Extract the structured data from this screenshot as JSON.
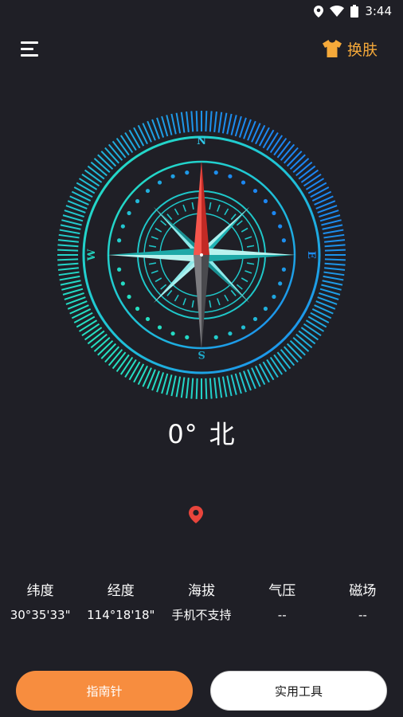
{
  "status_bar": {
    "time": "3:44",
    "icons": [
      "location-icon",
      "wifi-icon",
      "battery-icon"
    ]
  },
  "header": {
    "menu_icon": "hamburger-menu-icon",
    "skin_icon": "tshirt-icon",
    "skin_label": "换肤"
  },
  "compass": {
    "north": "N",
    "east": "E",
    "south": "S",
    "west": "W",
    "heading_degrees": "0°",
    "heading_direction": "北"
  },
  "location": {
    "icon": "map-pin-icon"
  },
  "info": [
    {
      "label": "纬度",
      "value": "30°35'33\""
    },
    {
      "label": "经度",
      "value": "114°18'18\""
    },
    {
      "label": "海拔",
      "value": "手机不支持"
    },
    {
      "label": "气压",
      "value": "--"
    },
    {
      "label": "磁场",
      "value": "--"
    }
  ],
  "buttons": {
    "compass_label": "指南针",
    "tools_label": "实用工具"
  },
  "colors": {
    "background": "#1f1f26",
    "accent_orange": "#f78d3f",
    "skin_label": "#f5a93a",
    "compass_teal": "#1fd3c1",
    "compass_blue": "#1c8cf0",
    "needle_red": "#e8352f",
    "pin_red": "#e8453c"
  }
}
